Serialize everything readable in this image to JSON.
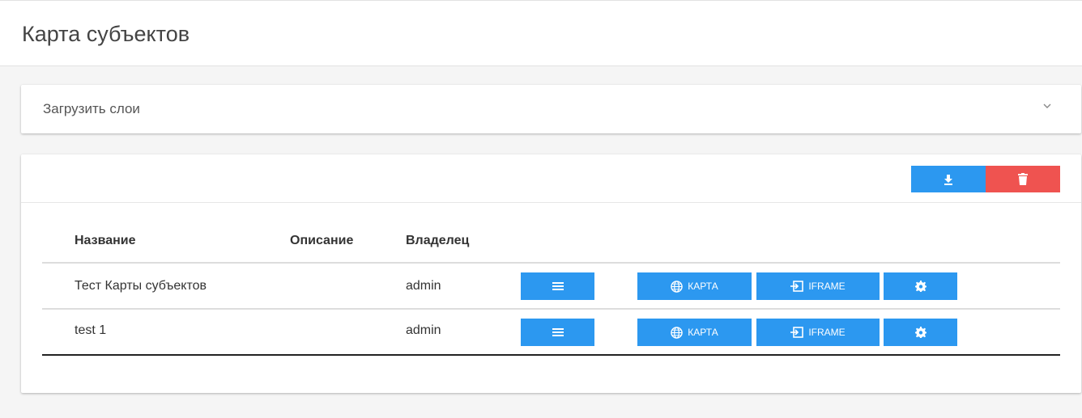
{
  "page": {
    "title": "Карта субъектов"
  },
  "load_layers": {
    "label": "Загрузить слои",
    "expand_icon": "chevron-down-icon"
  },
  "toolbar": {
    "download_icon": "download-icon",
    "delete_icon": "trash-icon",
    "colors": {
      "download": "#2c98f0",
      "delete": "#ef5350"
    }
  },
  "table": {
    "columns": [
      "Название",
      "Описание",
      "Владелец"
    ],
    "rows": [
      {
        "name": "Тест Карты субъектов",
        "description": "",
        "owner": "admin",
        "map_label": "КАРТА",
        "iframe_label": "IFRAME"
      },
      {
        "name": "test 1",
        "description": "",
        "owner": "admin",
        "map_label": "КАРТА",
        "iframe_label": "IFRAME"
      }
    ],
    "row_icons": [
      "list-icon",
      "globe-icon",
      "iframe-enter-icon",
      "gear-icon"
    ],
    "button_color": "#2c98f0"
  }
}
